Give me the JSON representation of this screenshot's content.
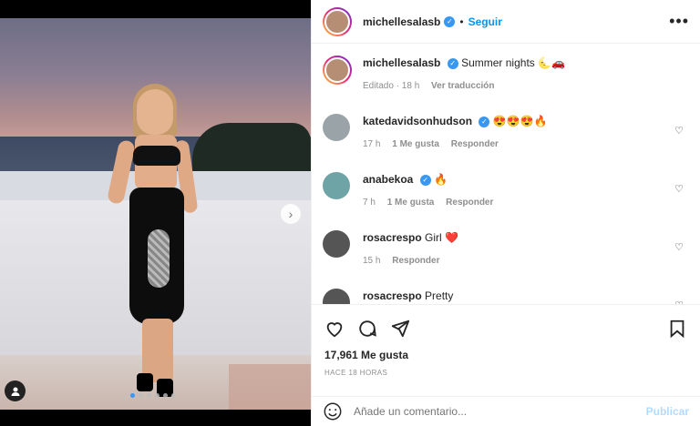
{
  "post": {
    "author": "michellesalasb",
    "follow_label": "Seguir",
    "separator": "•",
    "more_label": "•••",
    "caption_text": "Summer nights 🌜🚗",
    "caption_meta_edited": "Editado · 18 h",
    "caption_meta_translate": "Ver traducción",
    "carousel": {
      "total": 6,
      "active_index": 0
    }
  },
  "comments": [
    {
      "username": "katedavidsonhudson",
      "verified": true,
      "text": "😍😍😍🔥",
      "time": "17 h",
      "likes": "1 Me gusta",
      "reply": "Responder",
      "avatar_color": "#9aa3a8"
    },
    {
      "username": "anabekoa",
      "verified": true,
      "text": "🔥",
      "time": "7 h",
      "likes": "1 Me gusta",
      "reply": "Responder",
      "avatar_color": "#6fa4a7"
    },
    {
      "username": "rosacrespo",
      "verified": false,
      "text": "Girl ❤️",
      "time": "15 h",
      "likes": "",
      "reply": "Responder",
      "avatar_color": "#555"
    },
    {
      "username": "rosacrespo",
      "verified": false,
      "text": "Pretty",
      "time": "",
      "likes": "",
      "reply": "",
      "avatar_color": "#555"
    }
  ],
  "footer": {
    "likes": "17,961 Me gusta",
    "time_ago": "HACE 18 HORAS",
    "comment_placeholder": "Añade un comentario...",
    "publish_label": "Publicar"
  }
}
